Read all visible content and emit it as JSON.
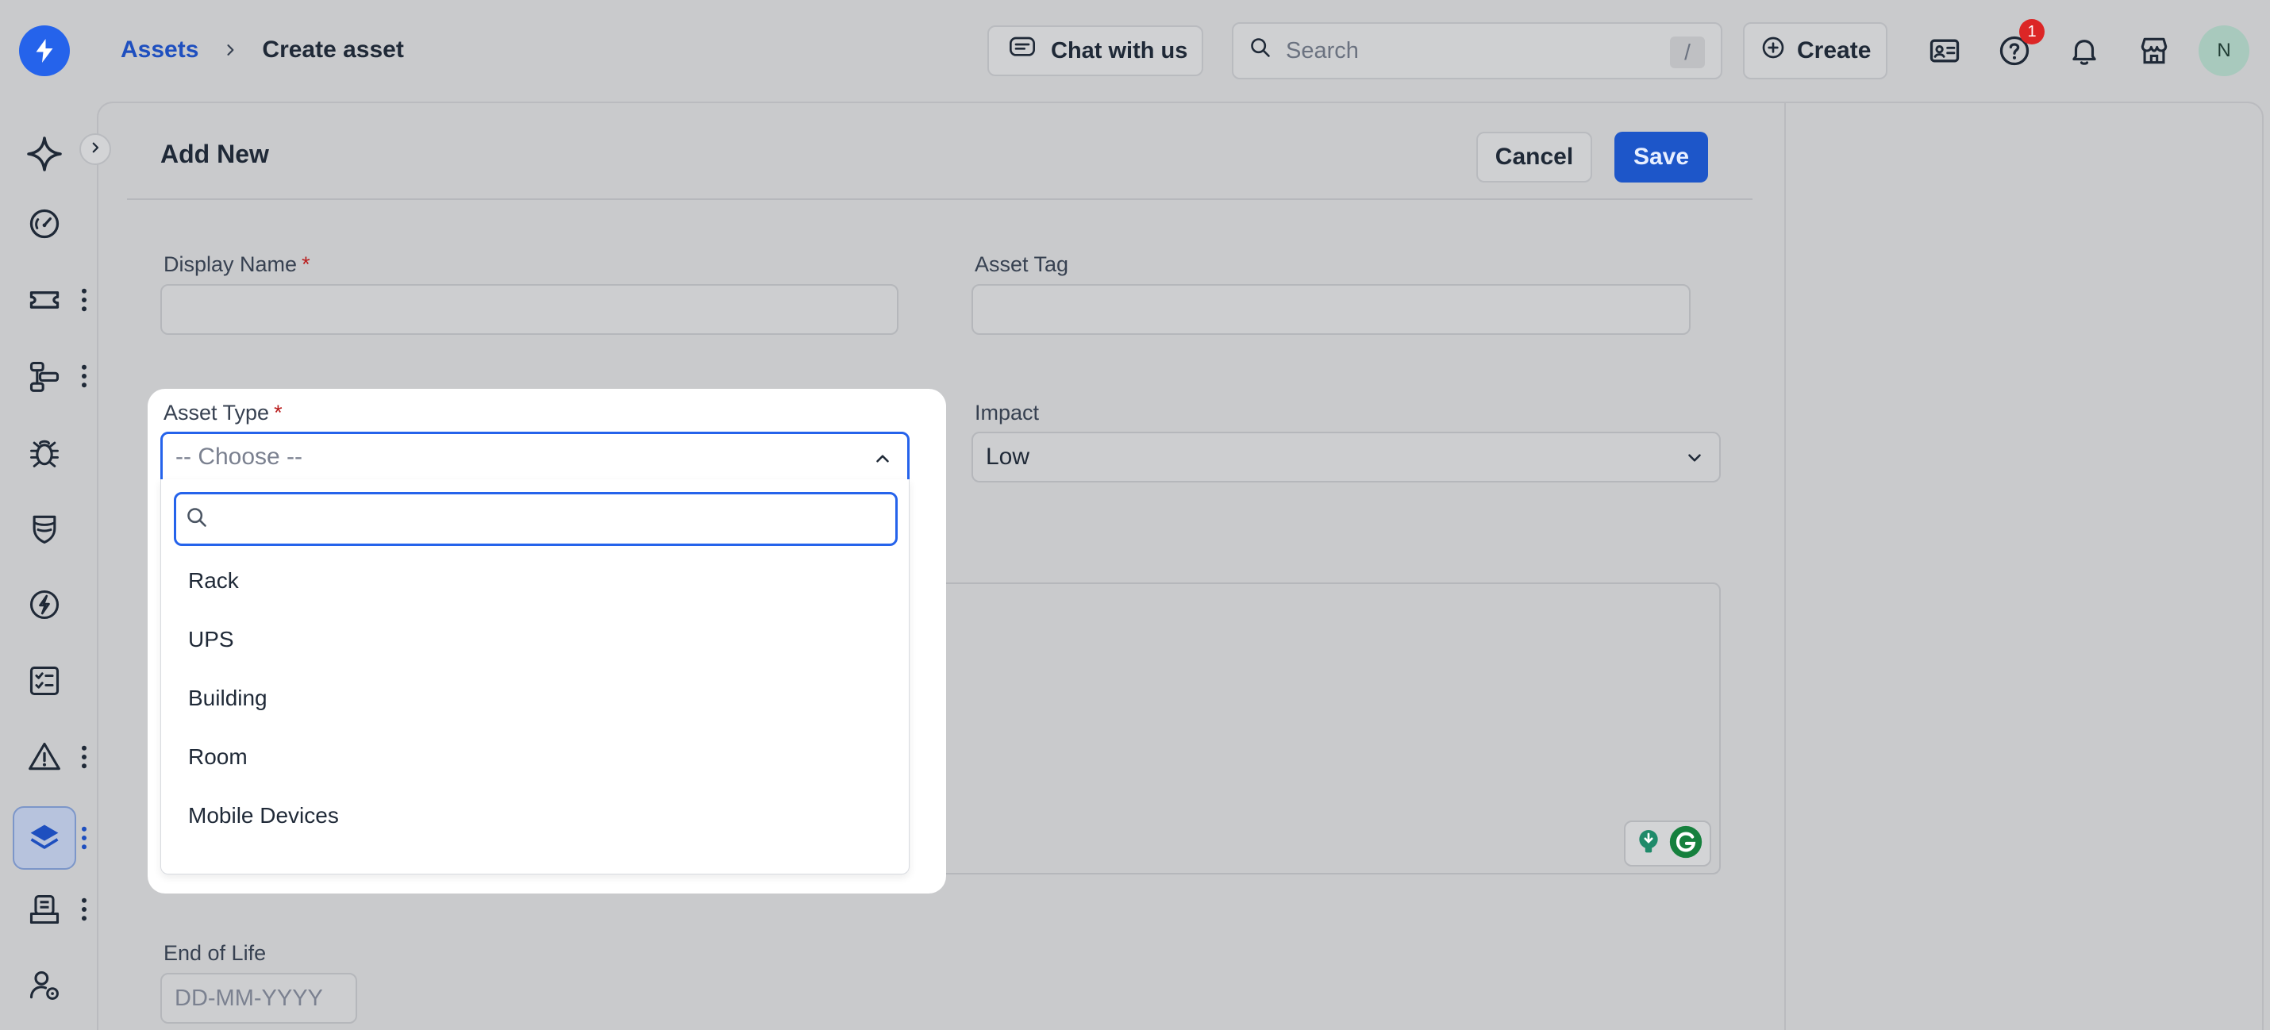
{
  "colors": {
    "accent": "#2563eb",
    "brand_logo": "#2563eb",
    "required": "#b91c1c",
    "badge": "#dc2626",
    "avatar": "#a8c9bd"
  },
  "topbar": {
    "breadcrumb": {
      "parent": "Assets",
      "current": "Create asset"
    },
    "chat_label": "Chat with us",
    "search": {
      "placeholder": "Search",
      "shortcut": "/"
    },
    "create_label": "Create",
    "help_badge_count": "1",
    "avatar_initial": "N",
    "icons": [
      "lightning-logo-icon",
      "contact-card-icon",
      "help-icon",
      "bell-icon",
      "store-icon"
    ]
  },
  "sidebar": {
    "icons": [
      "sparkle-icon",
      "gauge-icon",
      "ticket-icon",
      "workflow-icon",
      "bug-icon",
      "shield-icon",
      "change-icon",
      "checklist-icon",
      "alert-icon",
      "layers-icon",
      "inbox-icon",
      "user-settings-icon"
    ],
    "active": "layers-icon"
  },
  "form": {
    "title": "Add New",
    "cancel_label": "Cancel",
    "save_label": "Save",
    "display_name_label": "Display Name",
    "asset_tag_label": "Asset Tag",
    "asset_type_label": "Asset Type",
    "asset_type_placeholder": "-- Choose --",
    "impact_label": "Impact",
    "impact_value": "Low",
    "end_of_life_label": "End of Life",
    "end_of_life_placeholder": "DD-MM-YYYY",
    "required_mark": "*"
  },
  "dropdown": {
    "search_value": "",
    "options": [
      "Rack",
      "UPS",
      "Building",
      "Room",
      "Mobile Devices"
    ]
  }
}
